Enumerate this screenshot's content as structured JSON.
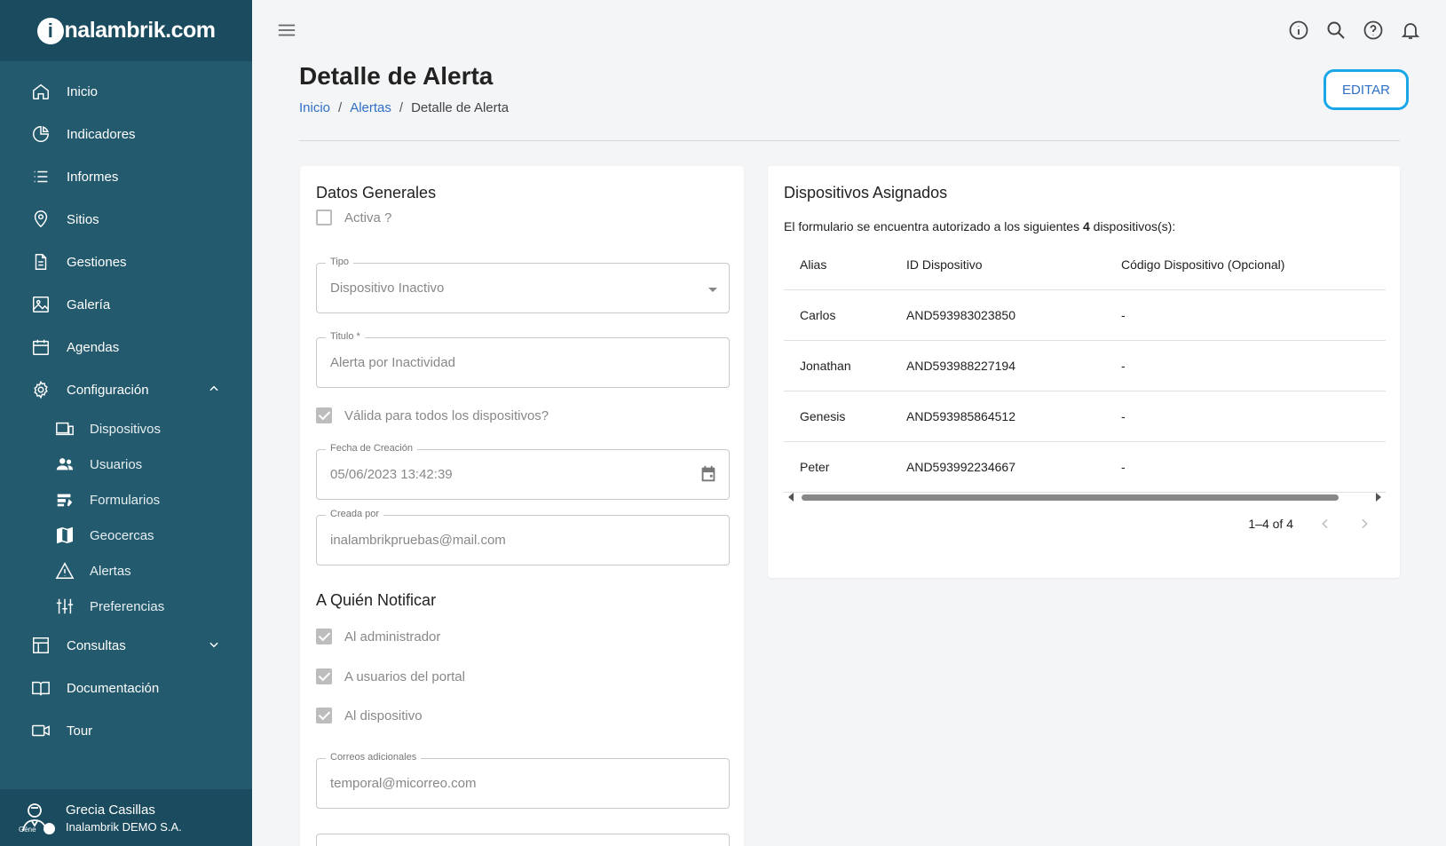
{
  "app": {
    "logo_i": "i",
    "logo_rest": "nalambrik.com"
  },
  "sidebar": {
    "items": [
      {
        "label": "Inicio",
        "icon": "home-icon"
      },
      {
        "label": "Indicadores",
        "icon": "pie-chart-icon"
      },
      {
        "label": "Informes",
        "icon": "list-icon"
      },
      {
        "label": "Sitios",
        "icon": "location-pin-icon"
      },
      {
        "label": "Gestiones",
        "icon": "document-icon"
      },
      {
        "label": "Galería",
        "icon": "image-icon"
      },
      {
        "label": "Agendas",
        "icon": "calendar-icon"
      },
      {
        "label": "Configuración",
        "icon": "gear-icon"
      }
    ],
    "sub_items": [
      {
        "label": "Dispositivos",
        "icon": "devices-icon"
      },
      {
        "label": "Usuarios",
        "icon": "users-icon"
      },
      {
        "label": "Formularios",
        "icon": "forms-icon"
      },
      {
        "label": "Geocercas",
        "icon": "map-icon"
      },
      {
        "label": "Alertas",
        "icon": "warning-icon"
      },
      {
        "label": "Preferencias",
        "icon": "sliders-icon"
      }
    ],
    "bottom_items": [
      {
        "label": "Consultas",
        "icon": "table-icon"
      },
      {
        "label": "Documentación",
        "icon": "book-icon"
      },
      {
        "label": "Tour",
        "icon": "video-icon"
      }
    ],
    "user": {
      "name": "Grecia Casillas",
      "org": "Inalambrik DEMO S.A.",
      "avatar_caption": "Géne"
    }
  },
  "header": {
    "title": "Detalle de Alerta",
    "breadcrumb": [
      "Inicio",
      "Alertas",
      "Detalle de Alerta"
    ],
    "edit_label": "EDITAR"
  },
  "general": {
    "title": "Datos Generales",
    "active_label": "Activa ?",
    "active_checked": false,
    "tipo_label": "Tipo",
    "tipo_value": "Dispositivo Inactivo",
    "titulo_label": "Titulo *",
    "titulo_value": "Alerta por Inactividad",
    "valid_all_label": "Válida para todos los dispositivos?",
    "valid_all_checked": true,
    "fecha_label": "Fecha de Creación",
    "fecha_value": "05/06/2023 13:42:39",
    "creada_label": "Creada por",
    "creada_value": "inalambrikpruebas@mail.com"
  },
  "notify": {
    "title": "A Quién Notificar",
    "admin_label": "Al administrador",
    "portal_label": "A usuarios del portal",
    "device_label": "Al dispositivo",
    "emails_label": "Correos adicionales",
    "emails_value": "temporal@micorreo.com"
  },
  "devices": {
    "title": "Dispositivos Asignados",
    "subtitle_pre": "El formulario se encuentra autorizado a los siguientes ",
    "subtitle_count": "4",
    "subtitle_post": " dispositivos(s):",
    "columns": [
      "Alias",
      "ID Dispositivo",
      "Código Dispositivo (Opcional)"
    ],
    "rows": [
      {
        "alias": "Carlos",
        "id": "AND593983023850",
        "code": "-"
      },
      {
        "alias": "Jonathan",
        "id": "AND593988227194",
        "code": "-"
      },
      {
        "alias": "Genesis",
        "id": "AND593985864512",
        "code": "-"
      },
      {
        "alias": "Peter",
        "id": "AND593992234667",
        "code": "-"
      }
    ],
    "pagination": "1–4 of 4"
  },
  "colors": {
    "sidebar": "#235a6e",
    "sidebar_dark": "#1a4b5e",
    "link": "#2f6fc6",
    "focus": "#1aa7e8"
  }
}
